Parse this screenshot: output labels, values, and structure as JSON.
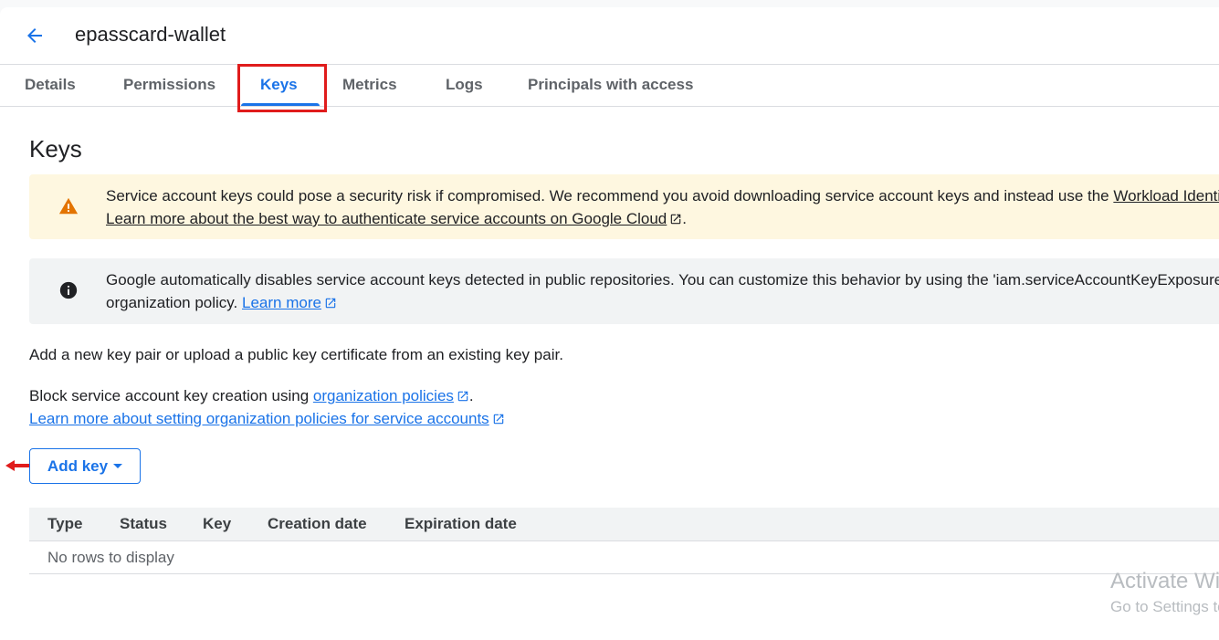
{
  "header": {
    "title": "epasscard-wallet"
  },
  "tabs": [
    {
      "label": "Details"
    },
    {
      "label": "Permissions"
    },
    {
      "label": "Keys"
    },
    {
      "label": "Metrics"
    },
    {
      "label": "Logs"
    },
    {
      "label": "Principals with access"
    }
  ],
  "active_tab": "Keys",
  "section": {
    "title": "Keys"
  },
  "warning_banner": {
    "text": "Service account keys could pose a security risk if compromised. We recommend you avoid downloading service account keys and instead use the ",
    "link1": "Workload Identity",
    "link2": "Learn more about the best way to authenticate service accounts on Google Cloud",
    "end": "."
  },
  "info_banner": {
    "text": "Google automatically disables service account keys detected in public repositories. You can customize this behavior by using the 'iam.serviceAccountKeyExposureResponse'",
    "text2": "organization policy. ",
    "link": "Learn more"
  },
  "description": "Add a new key pair or upload a public key certificate from an existing key pair.",
  "block_text": {
    "prefix": "Block service account key creation using ",
    "link": "organization policies",
    "suffix": ".",
    "learn_link": "Learn more about setting organization policies for service accounts"
  },
  "add_key_button": "Add key",
  "table": {
    "columns": [
      "Type",
      "Status",
      "Key",
      "Creation date",
      "Expiration date"
    ],
    "empty": "No rows to display"
  },
  "watermark": {
    "line1": "Activate Windows",
    "line2": "Go to Settings to activate Windows."
  },
  "colors": {
    "accent": "#1a73e8",
    "warning_bg": "#fef7e0",
    "warning_icon": "#e37400",
    "info_bg": "#f1f3f4",
    "highlight": "#e01c1c"
  }
}
